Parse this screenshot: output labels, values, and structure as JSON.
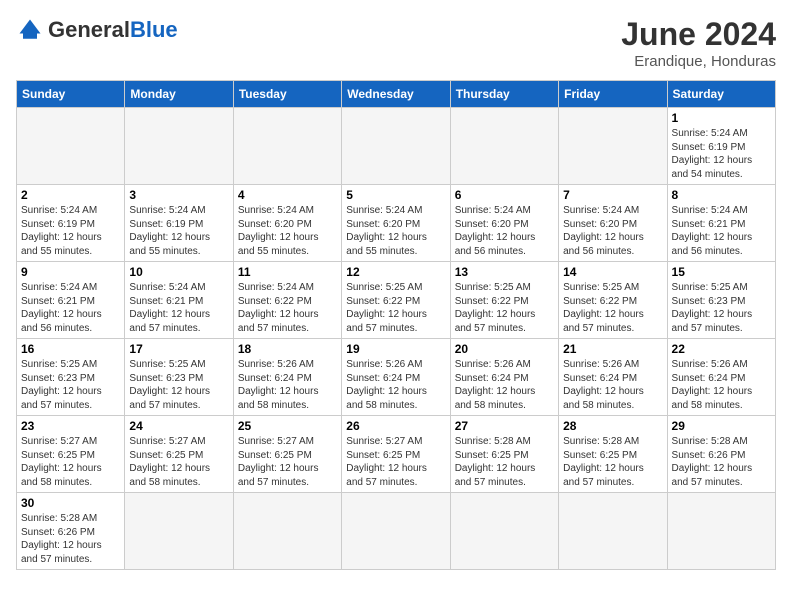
{
  "logo": {
    "general": "General",
    "blue": "Blue"
  },
  "title": "June 2024",
  "subtitle": "Erandique, Honduras",
  "days_of_week": [
    "Sunday",
    "Monday",
    "Tuesday",
    "Wednesday",
    "Thursday",
    "Friday",
    "Saturday"
  ],
  "weeks": [
    [
      {
        "day": "",
        "info": "",
        "empty": true
      },
      {
        "day": "",
        "info": "",
        "empty": true
      },
      {
        "day": "",
        "info": "",
        "empty": true
      },
      {
        "day": "",
        "info": "",
        "empty": true
      },
      {
        "day": "",
        "info": "",
        "empty": true
      },
      {
        "day": "",
        "info": "",
        "empty": true
      },
      {
        "day": "1",
        "info": "Sunrise: 5:24 AM\nSunset: 6:19 PM\nDaylight: 12 hours\nand 54 minutes."
      }
    ],
    [
      {
        "day": "2",
        "info": "Sunrise: 5:24 AM\nSunset: 6:19 PM\nDaylight: 12 hours\nand 55 minutes."
      },
      {
        "day": "3",
        "info": "Sunrise: 5:24 AM\nSunset: 6:19 PM\nDaylight: 12 hours\nand 55 minutes."
      },
      {
        "day": "4",
        "info": "Sunrise: 5:24 AM\nSunset: 6:20 PM\nDaylight: 12 hours\nand 55 minutes."
      },
      {
        "day": "5",
        "info": "Sunrise: 5:24 AM\nSunset: 6:20 PM\nDaylight: 12 hours\nand 55 minutes."
      },
      {
        "day": "6",
        "info": "Sunrise: 5:24 AM\nSunset: 6:20 PM\nDaylight: 12 hours\nand 56 minutes."
      },
      {
        "day": "7",
        "info": "Sunrise: 5:24 AM\nSunset: 6:20 PM\nDaylight: 12 hours\nand 56 minutes."
      },
      {
        "day": "8",
        "info": "Sunrise: 5:24 AM\nSunset: 6:21 PM\nDaylight: 12 hours\nand 56 minutes."
      }
    ],
    [
      {
        "day": "9",
        "info": "Sunrise: 5:24 AM\nSunset: 6:21 PM\nDaylight: 12 hours\nand 56 minutes."
      },
      {
        "day": "10",
        "info": "Sunrise: 5:24 AM\nSunset: 6:21 PM\nDaylight: 12 hours\nand 57 minutes."
      },
      {
        "day": "11",
        "info": "Sunrise: 5:24 AM\nSunset: 6:22 PM\nDaylight: 12 hours\nand 57 minutes."
      },
      {
        "day": "12",
        "info": "Sunrise: 5:25 AM\nSunset: 6:22 PM\nDaylight: 12 hours\nand 57 minutes."
      },
      {
        "day": "13",
        "info": "Sunrise: 5:25 AM\nSunset: 6:22 PM\nDaylight: 12 hours\nand 57 minutes."
      },
      {
        "day": "14",
        "info": "Sunrise: 5:25 AM\nSunset: 6:22 PM\nDaylight: 12 hours\nand 57 minutes."
      },
      {
        "day": "15",
        "info": "Sunrise: 5:25 AM\nSunset: 6:23 PM\nDaylight: 12 hours\nand 57 minutes."
      }
    ],
    [
      {
        "day": "16",
        "info": "Sunrise: 5:25 AM\nSunset: 6:23 PM\nDaylight: 12 hours\nand 57 minutes."
      },
      {
        "day": "17",
        "info": "Sunrise: 5:25 AM\nSunset: 6:23 PM\nDaylight: 12 hours\nand 57 minutes."
      },
      {
        "day": "18",
        "info": "Sunrise: 5:26 AM\nSunset: 6:24 PM\nDaylight: 12 hours\nand 58 minutes."
      },
      {
        "day": "19",
        "info": "Sunrise: 5:26 AM\nSunset: 6:24 PM\nDaylight: 12 hours\nand 58 minutes."
      },
      {
        "day": "20",
        "info": "Sunrise: 5:26 AM\nSunset: 6:24 PM\nDaylight: 12 hours\nand 58 minutes."
      },
      {
        "day": "21",
        "info": "Sunrise: 5:26 AM\nSunset: 6:24 PM\nDaylight: 12 hours\nand 58 minutes."
      },
      {
        "day": "22",
        "info": "Sunrise: 5:26 AM\nSunset: 6:24 PM\nDaylight: 12 hours\nand 58 minutes."
      }
    ],
    [
      {
        "day": "23",
        "info": "Sunrise: 5:27 AM\nSunset: 6:25 PM\nDaylight: 12 hours\nand 58 minutes."
      },
      {
        "day": "24",
        "info": "Sunrise: 5:27 AM\nSunset: 6:25 PM\nDaylight: 12 hours\nand 58 minutes."
      },
      {
        "day": "25",
        "info": "Sunrise: 5:27 AM\nSunset: 6:25 PM\nDaylight: 12 hours\nand 57 minutes."
      },
      {
        "day": "26",
        "info": "Sunrise: 5:27 AM\nSunset: 6:25 PM\nDaylight: 12 hours\nand 57 minutes."
      },
      {
        "day": "27",
        "info": "Sunrise: 5:28 AM\nSunset: 6:25 PM\nDaylight: 12 hours\nand 57 minutes."
      },
      {
        "day": "28",
        "info": "Sunrise: 5:28 AM\nSunset: 6:25 PM\nDaylight: 12 hours\nand 57 minutes."
      },
      {
        "day": "29",
        "info": "Sunrise: 5:28 AM\nSunset: 6:26 PM\nDaylight: 12 hours\nand 57 minutes."
      }
    ],
    [
      {
        "day": "30",
        "info": "Sunrise: 5:28 AM\nSunset: 6:26 PM\nDaylight: 12 hours\nand 57 minutes."
      },
      {
        "day": "",
        "info": "",
        "empty": true
      },
      {
        "day": "",
        "info": "",
        "empty": true
      },
      {
        "day": "",
        "info": "",
        "empty": true
      },
      {
        "day": "",
        "info": "",
        "empty": true
      },
      {
        "day": "",
        "info": "",
        "empty": true
      },
      {
        "day": "",
        "info": "",
        "empty": true
      }
    ]
  ]
}
